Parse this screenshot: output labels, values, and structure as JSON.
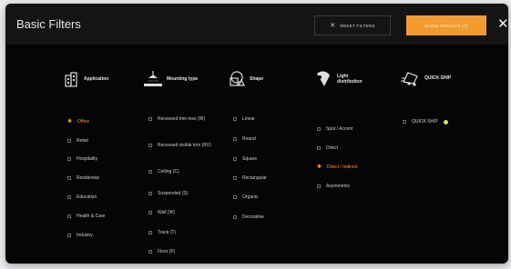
{
  "header": {
    "title": "Basic Filters",
    "reset_label": "RESET FILTERS",
    "results_label": "SHOW RESULTS (7)",
    "close_icon": "close-icon"
  },
  "categories": [
    {
      "label": "Application",
      "icon": "building-icon",
      "options": [
        {
          "label": "Office",
          "selected": true
        },
        {
          "label": "Retail",
          "selected": false
        },
        {
          "label": "Hospitality",
          "selected": false
        },
        {
          "label": "Residential",
          "selected": false
        },
        {
          "label": "Education",
          "selected": false
        },
        {
          "label": "Health & Care",
          "selected": false
        },
        {
          "label": "Industry",
          "selected": false
        }
      ]
    },
    {
      "label": "Mounting type",
      "icon": "ceiling-lamp-icon",
      "options": [
        {
          "label": "Recessed trim-less (RI)",
          "selected": false
        },
        {
          "label": "Recessed visible trim (RV)",
          "selected": false
        },
        {
          "label": "Ceiling (C)",
          "selected": false
        },
        {
          "label": "Suspended (S)",
          "selected": false
        },
        {
          "label": "Wall (W)",
          "selected": false
        },
        {
          "label": "Track (T)",
          "selected": false
        },
        {
          "label": "Floor (F)",
          "selected": false
        }
      ]
    },
    {
      "label": "Shape",
      "icon": "shapes-icon",
      "options": [
        {
          "label": "Linear",
          "selected": false
        },
        {
          "label": "Round",
          "selected": false
        },
        {
          "label": "Square",
          "selected": false
        },
        {
          "label": "Rectangular",
          "selected": false
        },
        {
          "label": "Organic",
          "selected": false
        },
        {
          "label": "Decorative",
          "selected": false
        }
      ]
    },
    {
      "label": "Light distribution",
      "icon": "light-beam-icon",
      "options": [
        {
          "label": "Spot / Accent",
          "selected": false
        },
        {
          "label": "Direct",
          "selected": false
        },
        {
          "label": "Direct / Indirect",
          "selected": true
        },
        {
          "label": "Asymmetric",
          "selected": false
        }
      ]
    },
    {
      "label": "QUICK SHIP",
      "icon": "truck-icon",
      "options": [
        {
          "label": "QUICK SHIP",
          "selected": false,
          "dot_color": "#d6e24a"
        }
      ]
    }
  ],
  "colors": {
    "accent": "#f29b2f",
    "background": "#050505",
    "header": "#141414"
  }
}
